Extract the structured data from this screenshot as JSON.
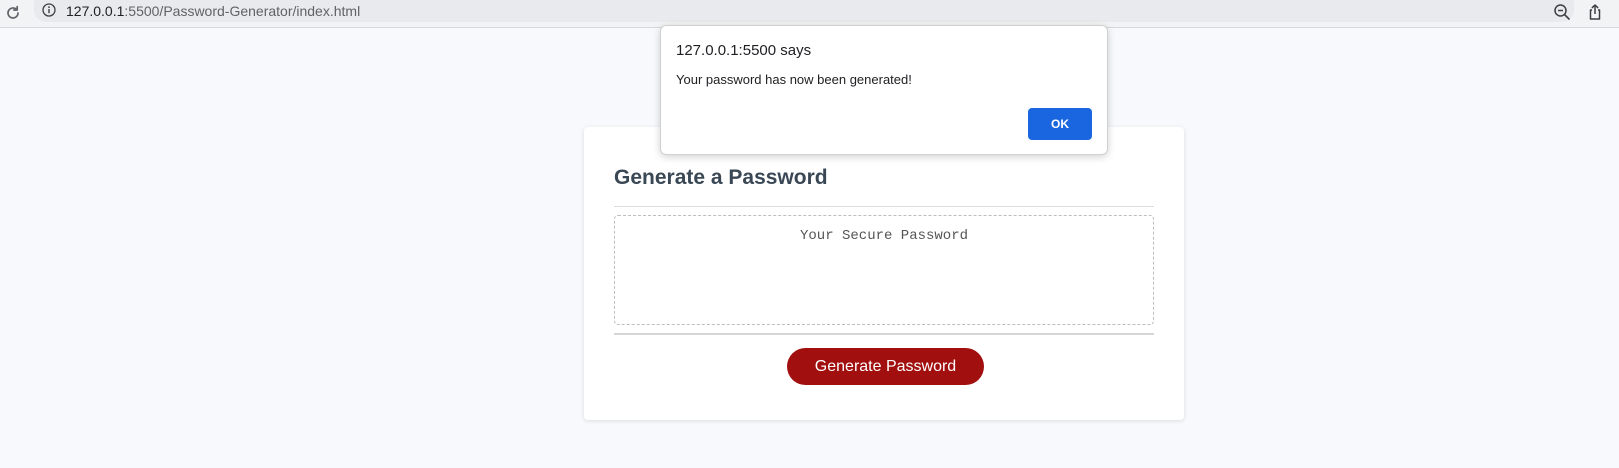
{
  "browser": {
    "url_host": "127.0.0.1",
    "url_rest": ":5500/Password-Generator/index.html",
    "icons": {
      "reload": "reload-icon",
      "site_info": "info-icon",
      "zoom": "zoom-out-icon",
      "share": "share-icon"
    }
  },
  "card": {
    "title": "Generate a Password",
    "password_placeholder": "Your Secure Password",
    "generate_label": "Generate Password"
  },
  "dialog": {
    "title": "127.0.0.1:5500 says",
    "message": "Your password has now been generated!",
    "ok_label": "OK"
  },
  "colors": {
    "accent_button": "#a10f0f",
    "dialog_ok": "#1a66e0",
    "title_text": "#3a4856",
    "page_background": "#f8f9fc"
  }
}
